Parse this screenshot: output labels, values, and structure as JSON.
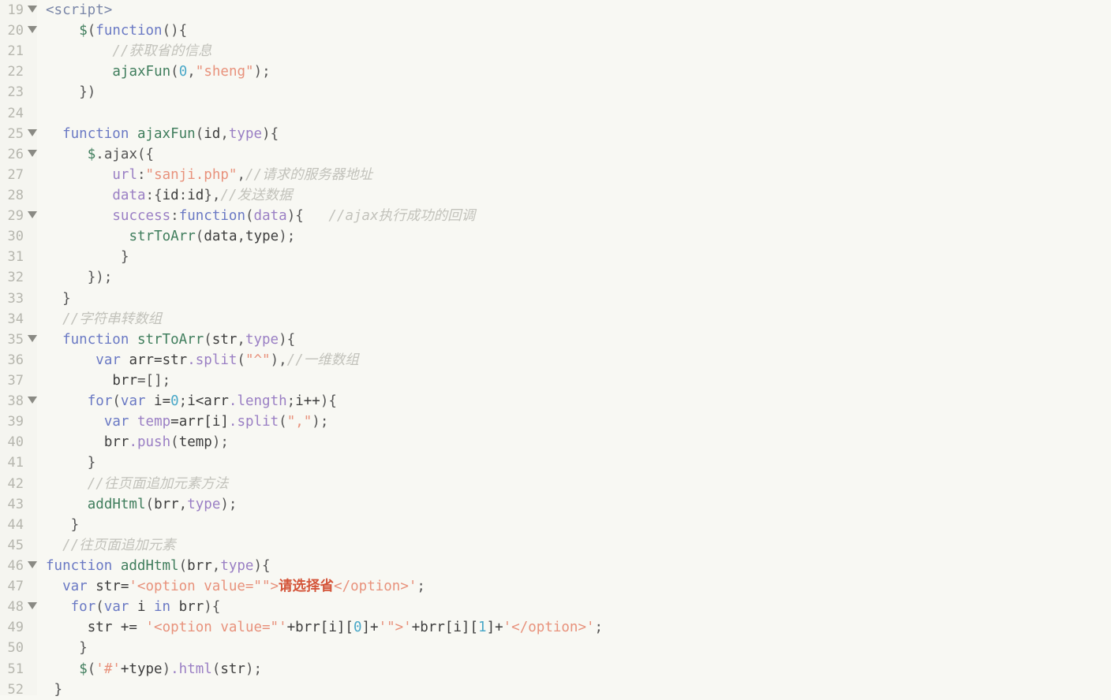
{
  "editor": {
    "name": "code-editor",
    "language": "javascript-html",
    "background_color": "#f8f8f3",
    "gutter_color": "#f5f5f0",
    "first_line_number": 19,
    "last_line_number": 52,
    "fold_marker": "▼",
    "colors": {
      "text": "#3d3d3d",
      "line_number": "#b6b6ae",
      "tag": "#7a86a8",
      "keyword": "#6a79c4",
      "function_name": "#3f7d5c",
      "property": "#9a7fc4",
      "string": "#e8927c",
      "string_cjk": "#d4553a",
      "number": "#4aa8c8",
      "comment": "#c2c2bb"
    }
  },
  "lines": [
    {
      "number": "19",
      "fold": true,
      "indent": 0,
      "tokens": [
        {
          "t": "<script>",
          "c": "t-tag"
        }
      ]
    },
    {
      "number": "20",
      "fold": true,
      "indent": 4,
      "tokens": [
        {
          "t": "$",
          "c": "t-dollar"
        },
        {
          "t": "(",
          "c": "t-punc"
        },
        {
          "t": "function",
          "c": "t-kw"
        },
        {
          "t": "(){",
          "c": "t-punc"
        }
      ]
    },
    {
      "number": "21",
      "fold": false,
      "indent": 8,
      "tokens": [
        {
          "t": "//获取省的信息",
          "c": "t-comment"
        }
      ]
    },
    {
      "number": "22",
      "fold": false,
      "indent": 8,
      "tokens": [
        {
          "t": "ajaxFun",
          "c": "t-fn"
        },
        {
          "t": "(",
          "c": "t-punc"
        },
        {
          "t": "0",
          "c": "t-num"
        },
        {
          "t": ",",
          "c": "t-punc"
        },
        {
          "t": "\"sheng\"",
          "c": "t-str"
        },
        {
          "t": ");",
          "c": "t-punc"
        }
      ]
    },
    {
      "number": "23",
      "fold": false,
      "indent": 4,
      "tokens": [
        {
          "t": "})",
          "c": "t-punc"
        }
      ]
    },
    {
      "number": "24",
      "fold": false,
      "indent": 0,
      "tokens": []
    },
    {
      "number": "25",
      "fold": true,
      "indent": 2,
      "tokens": [
        {
          "t": "function",
          "c": "t-kw"
        },
        {
          "t": " ",
          "c": "t-plain"
        },
        {
          "t": "ajaxFun",
          "c": "t-fn"
        },
        {
          "t": "(",
          "c": "t-punc"
        },
        {
          "t": "id",
          "c": "t-plain"
        },
        {
          "t": ",",
          "c": "t-punc"
        },
        {
          "t": "type",
          "c": "t-prop"
        },
        {
          "t": "){",
          "c": "t-punc"
        }
      ]
    },
    {
      "number": "26",
      "fold": true,
      "indent": 5,
      "tokens": [
        {
          "t": "$",
          "c": "t-dollar"
        },
        {
          "t": ".ajax({",
          "c": "t-punc"
        }
      ]
    },
    {
      "number": "27",
      "fold": false,
      "indent": 8,
      "tokens": [
        {
          "t": "url",
          "c": "t-prop"
        },
        {
          "t": ":",
          "c": "t-punc"
        },
        {
          "t": "\"sanji.php\"",
          "c": "t-str"
        },
        {
          "t": ",",
          "c": "t-punc"
        },
        {
          "t": "//请求的服务器地址",
          "c": "t-comment"
        }
      ]
    },
    {
      "number": "28",
      "fold": false,
      "indent": 8,
      "tokens": [
        {
          "t": "data",
          "c": "t-prop"
        },
        {
          "t": ":{",
          "c": "t-punc"
        },
        {
          "t": "id",
          "c": "t-plain"
        },
        {
          "t": ":",
          "c": "t-punc"
        },
        {
          "t": "id",
          "c": "t-plain"
        },
        {
          "t": "},",
          "c": "t-punc"
        },
        {
          "t": "//发送数据",
          "c": "t-comment"
        }
      ]
    },
    {
      "number": "29",
      "fold": true,
      "indent": 8,
      "tokens": [
        {
          "t": "success",
          "c": "t-prop"
        },
        {
          "t": ":",
          "c": "t-punc"
        },
        {
          "t": "function",
          "c": "t-kw"
        },
        {
          "t": "(",
          "c": "t-punc"
        },
        {
          "t": "data",
          "c": "t-prop"
        },
        {
          "t": "){",
          "c": "t-punc"
        },
        {
          "t": "   ",
          "c": "t-plain"
        },
        {
          "t": "//ajax执行成功的回调",
          "c": "t-comment"
        }
      ]
    },
    {
      "number": "30",
      "fold": false,
      "indent": 10,
      "tokens": [
        {
          "t": "strToArr",
          "c": "t-fn"
        },
        {
          "t": "(",
          "c": "t-punc"
        },
        {
          "t": "data",
          "c": "t-plain"
        },
        {
          "t": ",",
          "c": "t-punc"
        },
        {
          "t": "type",
          "c": "t-plain"
        },
        {
          "t": ");",
          "c": "t-punc"
        }
      ]
    },
    {
      "number": "31",
      "fold": false,
      "indent": 9,
      "tokens": [
        {
          "t": "}",
          "c": "t-punc"
        }
      ]
    },
    {
      "number": "32",
      "fold": false,
      "indent": 5,
      "tokens": [
        {
          "t": "});",
          "c": "t-punc"
        }
      ]
    },
    {
      "number": "33",
      "fold": false,
      "indent": 2,
      "tokens": [
        {
          "t": "}",
          "c": "t-punc"
        }
      ]
    },
    {
      "number": "34",
      "fold": false,
      "indent": 2,
      "tokens": [
        {
          "t": "//字符串转数组",
          "c": "t-comment"
        }
      ]
    },
    {
      "number": "35",
      "fold": true,
      "indent": 2,
      "tokens": [
        {
          "t": "function",
          "c": "t-kw"
        },
        {
          "t": " ",
          "c": "t-plain"
        },
        {
          "t": "strToArr",
          "c": "t-fn"
        },
        {
          "t": "(",
          "c": "t-punc"
        },
        {
          "t": "str",
          "c": "t-plain"
        },
        {
          "t": ",",
          "c": "t-punc"
        },
        {
          "t": "type",
          "c": "t-prop"
        },
        {
          "t": "){",
          "c": "t-punc"
        }
      ]
    },
    {
      "number": "36",
      "fold": false,
      "indent": 6,
      "tokens": [
        {
          "t": "var",
          "c": "t-kw"
        },
        {
          "t": " arr=str",
          "c": "t-plain"
        },
        {
          "t": ".split",
          "c": "t-prop"
        },
        {
          "t": "(",
          "c": "t-punc"
        },
        {
          "t": "\"^\"",
          "c": "t-str"
        },
        {
          "t": "),",
          "c": "t-punc"
        },
        {
          "t": "//一维数组",
          "c": "t-comment"
        }
      ]
    },
    {
      "number": "37",
      "fold": false,
      "indent": 8,
      "tokens": [
        {
          "t": "brr",
          "c": "t-plain"
        },
        {
          "t": "=[];",
          "c": "t-punc"
        }
      ]
    },
    {
      "number": "38",
      "fold": true,
      "indent": 5,
      "tokens": [
        {
          "t": "for",
          "c": "t-kw"
        },
        {
          "t": "(",
          "c": "t-punc"
        },
        {
          "t": "var",
          "c": "t-kw"
        },
        {
          "t": " i=",
          "c": "t-plain"
        },
        {
          "t": "0",
          "c": "t-num"
        },
        {
          "t": ";",
          "c": "t-punc"
        },
        {
          "t": "i<arr",
          "c": "t-plain"
        },
        {
          "t": ".length",
          "c": "t-prop"
        },
        {
          "t": ";",
          "c": "t-punc"
        },
        {
          "t": "i++",
          "c": "t-plain"
        },
        {
          "t": "){",
          "c": "t-punc"
        }
      ]
    },
    {
      "number": "39",
      "fold": false,
      "indent": 7,
      "tokens": [
        {
          "t": "var",
          "c": "t-kw"
        },
        {
          "t": " ",
          "c": "t-plain"
        },
        {
          "t": "temp",
          "c": "t-prop"
        },
        {
          "t": "=arr[i]",
          "c": "t-plain"
        },
        {
          "t": ".split",
          "c": "t-prop"
        },
        {
          "t": "(",
          "c": "t-punc"
        },
        {
          "t": "\",\"",
          "c": "t-str"
        },
        {
          "t": ");",
          "c": "t-punc"
        }
      ]
    },
    {
      "number": "40",
      "fold": false,
      "indent": 7,
      "tokens": [
        {
          "t": "brr",
          "c": "t-plain"
        },
        {
          "t": ".push",
          "c": "t-prop"
        },
        {
          "t": "(",
          "c": "t-punc"
        },
        {
          "t": "temp",
          "c": "t-plain"
        },
        {
          "t": ");",
          "c": "t-punc"
        }
      ]
    },
    {
      "number": "41",
      "fold": false,
      "indent": 5,
      "tokens": [
        {
          "t": "}",
          "c": "t-punc"
        }
      ]
    },
    {
      "number": "42",
      "fold": false,
      "indent": 5,
      "tokens": [
        {
          "t": "//往页面追加元素方法",
          "c": "t-comment"
        }
      ]
    },
    {
      "number": "43",
      "fold": false,
      "indent": 5,
      "tokens": [
        {
          "t": "addHtml",
          "c": "t-fn"
        },
        {
          "t": "(",
          "c": "t-punc"
        },
        {
          "t": "brr",
          "c": "t-plain"
        },
        {
          "t": ",",
          "c": "t-punc"
        },
        {
          "t": "type",
          "c": "t-prop"
        },
        {
          "t": ");",
          "c": "t-punc"
        }
      ]
    },
    {
      "number": "44",
      "fold": false,
      "indent": 3,
      "tokens": [
        {
          "t": "}",
          "c": "t-punc"
        }
      ]
    },
    {
      "number": "45",
      "fold": false,
      "indent": 2,
      "tokens": [
        {
          "t": "//往页面追加元素",
          "c": "t-comment"
        }
      ]
    },
    {
      "number": "46",
      "fold": true,
      "indent": 0,
      "tokens": [
        {
          "t": "function",
          "c": "t-kw"
        },
        {
          "t": " ",
          "c": "t-plain"
        },
        {
          "t": "addHtml",
          "c": "t-fn"
        },
        {
          "t": "(",
          "c": "t-punc"
        },
        {
          "t": "brr",
          "c": "t-plain"
        },
        {
          "t": ",",
          "c": "t-punc"
        },
        {
          "t": "type",
          "c": "t-prop"
        },
        {
          "t": "){",
          "c": "t-punc"
        }
      ]
    },
    {
      "number": "47",
      "fold": false,
      "indent": 2,
      "tokens": [
        {
          "t": "var",
          "c": "t-kw"
        },
        {
          "t": " str=",
          "c": "t-plain"
        },
        {
          "t": "'<option value=\"\">",
          "c": "t-str"
        },
        {
          "t": "请选择省",
          "c": "t-strcn"
        },
        {
          "t": "</option>'",
          "c": "t-str"
        },
        {
          "t": ";",
          "c": "t-punc"
        }
      ]
    },
    {
      "number": "48",
      "fold": true,
      "indent": 3,
      "tokens": [
        {
          "t": "for",
          "c": "t-kw"
        },
        {
          "t": "(",
          "c": "t-punc"
        },
        {
          "t": "var",
          "c": "t-kw"
        },
        {
          "t": " i ",
          "c": "t-plain"
        },
        {
          "t": "in",
          "c": "t-kw"
        },
        {
          "t": " brr",
          "c": "t-plain"
        },
        {
          "t": "){",
          "c": "t-punc"
        }
      ]
    },
    {
      "number": "49",
      "fold": false,
      "indent": 5,
      "tokens": [
        {
          "t": "str += ",
          "c": "t-plain"
        },
        {
          "t": "'<option value=\"'",
          "c": "t-str"
        },
        {
          "t": "+brr[i][",
          "c": "t-plain"
        },
        {
          "t": "0",
          "c": "t-num"
        },
        {
          "t": "]+",
          "c": "t-plain"
        },
        {
          "t": "'\">'",
          "c": "t-str"
        },
        {
          "t": "+brr[i][",
          "c": "t-plain"
        },
        {
          "t": "1",
          "c": "t-num"
        },
        {
          "t": "]+",
          "c": "t-plain"
        },
        {
          "t": "'</option>'",
          "c": "t-str"
        },
        {
          "t": ";",
          "c": "t-punc"
        }
      ]
    },
    {
      "number": "50",
      "fold": false,
      "indent": 4,
      "tokens": [
        {
          "t": "}",
          "c": "t-punc"
        }
      ]
    },
    {
      "number": "51",
      "fold": false,
      "indent": 4,
      "tokens": [
        {
          "t": "$",
          "c": "t-dollar"
        },
        {
          "t": "(",
          "c": "t-punc"
        },
        {
          "t": "'#'",
          "c": "t-str"
        },
        {
          "t": "+type",
          "c": "t-plain"
        },
        {
          "t": ")",
          "c": "t-punc"
        },
        {
          "t": ".html",
          "c": "t-prop"
        },
        {
          "t": "(",
          "c": "t-punc"
        },
        {
          "t": "str",
          "c": "t-plain"
        },
        {
          "t": ");",
          "c": "t-punc"
        }
      ]
    },
    {
      "number": "52",
      "fold": false,
      "indent": 1,
      "tokens": [
        {
          "t": "}",
          "c": "t-punc"
        }
      ]
    }
  ]
}
